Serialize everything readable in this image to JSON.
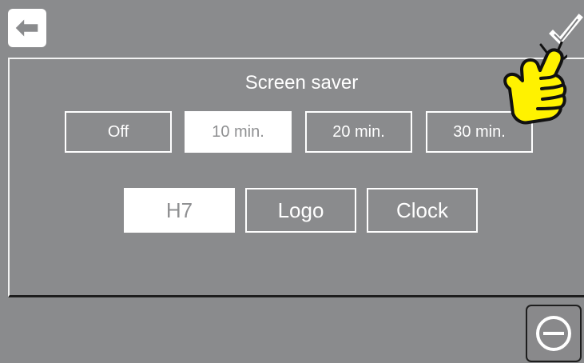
{
  "header": {
    "back_icon": "arrow-left-icon",
    "confirm_icon": "checkmark-icon"
  },
  "screen_saver": {
    "title": "Screen saver",
    "timeouts": [
      "Off",
      "10 min.",
      "20 min.",
      "30 min."
    ],
    "selected_timeout": "10 min.",
    "modes": [
      "H7",
      "Logo",
      "Clock"
    ],
    "selected_mode": "H7"
  },
  "footer": {
    "minus_icon": "minus-circle-icon"
  },
  "overlay": {
    "pointer_icon": "pointing-hand-icon"
  },
  "colors": {
    "background": "#8a8b8d",
    "white": "#ffffff",
    "selected_text": "#8f9092",
    "hand_yellow": "#fff200",
    "dark": "#1e1e1e"
  }
}
